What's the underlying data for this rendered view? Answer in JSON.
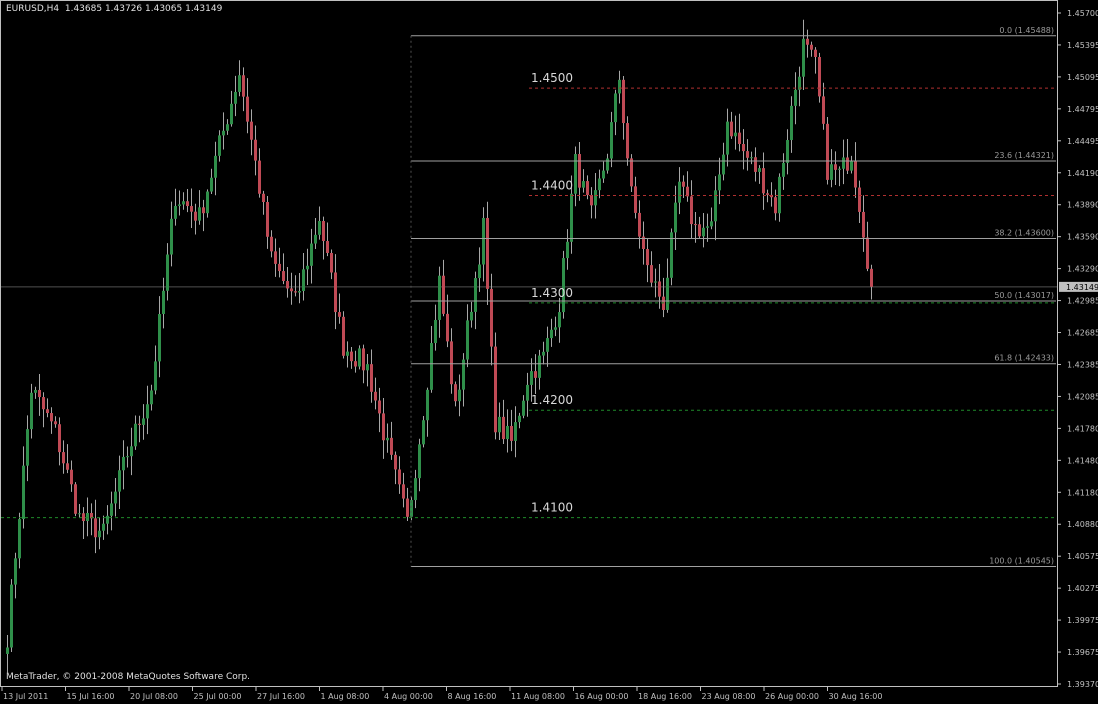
{
  "header": {
    "symbol": "EURUSD,H4",
    "ohlc": "1.43685 1.43726 1.43065 1.43149"
  },
  "copyright": "MetaTrader, © 2001-2008 MetaQuotes Software Corp.",
  "colors": {
    "background": "#000000",
    "frame": "#c0c0c0",
    "bull_candle": "#2f8f4a",
    "bear_candle": "#c04a55",
    "wick": "#a8a8a8",
    "fib_line": "#a0a0a0",
    "level_red": "#b03030",
    "level_green": "#1f8a2a",
    "text": "#c0c0c0",
    "price_tag_bg": "#c0c0c0",
    "price_tag_text": "#000000"
  },
  "chart_data": {
    "type": "candlestick",
    "instrument": "EURUSD",
    "timeframe": "H4",
    "ylim": [
      1.3945,
      1.457
    ],
    "y_ticks": [
      "1.45700",
      "1.45395",
      "1.45095",
      "1.44795",
      "1.44495",
      "1.44190",
      "1.43890",
      "1.43590",
      "1.43290",
      "1.42985",
      "1.42685",
      "1.42385",
      "1.42085",
      "1.41780",
      "1.41480",
      "1.41180",
      "1.40880",
      "1.40575",
      "1.40275",
      "1.39975",
      "1.39675",
      "1.39370"
    ],
    "x_ticks": [
      "13 Jul 2011",
      "15 Jul 16:00",
      "20 Jul 08:00",
      "25 Jul 00:00",
      "27 Jul 16:00",
      "1 Aug 08:00",
      "4 Aug 00:00",
      "8 Aug 16:00",
      "11 Aug 08:00",
      "16 Aug 00:00",
      "18 Aug 16:00",
      "23 Aug 08:00",
      "26 Aug 00:00",
      "30 Aug 16:00"
    ],
    "current_price": "1.43149",
    "current_price_value": 1.43149,
    "fibonacci": {
      "levels": [
        {
          "label": "0.0 (1.45488)",
          "price": 1.45488
        },
        {
          "label": "23.6 (1.44321)",
          "price": 1.44321
        },
        {
          "label": "38.2 (1.43600)",
          "price": 1.436
        },
        {
          "label": "50.0 (1.43017)",
          "price": 1.43017
        },
        {
          "label": "61.8 (1.42433)",
          "price": 1.42433
        },
        {
          "label": "100.0 (1.40545)",
          "price": 1.40545
        }
      ]
    },
    "round_levels": [
      {
        "label": "1.4500",
        "price": 1.45,
        "color": "red"
      },
      {
        "label": "1.4400",
        "price": 1.44,
        "color": "red"
      },
      {
        "label": "1.4300",
        "price": 1.43,
        "color": "green"
      },
      {
        "label": "1.4200",
        "price": 1.42,
        "color": "green"
      },
      {
        "label": "1.4100",
        "price": 1.41,
        "color": "green"
      }
    ],
    "anchors": [
      {
        "bar": 0,
        "price": 1.399
      },
      {
        "bar": 6,
        "price": 1.422
      },
      {
        "bar": 12,
        "price": 1.418
      },
      {
        "bar": 18,
        "price": 1.41
      },
      {
        "bar": 24,
        "price": 1.4085
      },
      {
        "bar": 30,
        "price": 1.416
      },
      {
        "bar": 36,
        "price": 1.422
      },
      {
        "bar": 42,
        "price": 1.44
      },
      {
        "bar": 48,
        "price": 1.438
      },
      {
        "bar": 54,
        "price": 1.446
      },
      {
        "bar": 58,
        "price": 1.4515
      },
      {
        "bar": 62,
        "price": 1.443
      },
      {
        "bar": 66,
        "price": 1.434
      },
      {
        "bar": 72,
        "price": 1.43
      },
      {
        "bar": 78,
        "price": 1.438
      },
      {
        "bar": 84,
        "price": 1.426
      },
      {
        "bar": 90,
        "price": 1.424
      },
      {
        "bar": 96,
        "price": 1.415
      },
      {
        "bar": 100,
        "price": 1.4095
      },
      {
        "bar": 104,
        "price": 1.42
      },
      {
        "bar": 108,
        "price": 1.432
      },
      {
        "bar": 112,
        "price": 1.42
      },
      {
        "bar": 116,
        "price": 1.43
      },
      {
        "bar": 119,
        "price": 1.437
      },
      {
        "bar": 122,
        "price": 1.419
      },
      {
        "bar": 126,
        "price": 1.417
      },
      {
        "bar": 130,
        "price": 1.423
      },
      {
        "bar": 134,
        "price": 1.425
      },
      {
        "bar": 138,
        "price": 1.43
      },
      {
        "bar": 142,
        "price": 1.443
      },
      {
        "bar": 146,
        "price": 1.438
      },
      {
        "bar": 150,
        "price": 1.444
      },
      {
        "bar": 153,
        "price": 1.451
      },
      {
        "bar": 156,
        "price": 1.44
      },
      {
        "bar": 160,
        "price": 1.433
      },
      {
        "bar": 164,
        "price": 1.43
      },
      {
        "bar": 168,
        "price": 1.441
      },
      {
        "bar": 172,
        "price": 1.437
      },
      {
        "bar": 176,
        "price": 1.437
      },
      {
        "bar": 180,
        "price": 1.447
      },
      {
        "bar": 184,
        "price": 1.444
      },
      {
        "bar": 188,
        "price": 1.442
      },
      {
        "bar": 192,
        "price": 1.439
      },
      {
        "bar": 196,
        "price": 1.448
      },
      {
        "bar": 199,
        "price": 1.454
      },
      {
        "bar": 202,
        "price": 1.452
      },
      {
        "bar": 205,
        "price": 1.4425
      },
      {
        "bar": 208,
        "price": 1.442
      },
      {
        "bar": 211,
        "price": 1.444
      },
      {
        "bar": 214,
        "price": 1.437
      },
      {
        "bar": 216,
        "price": 1.4315
      }
    ]
  }
}
